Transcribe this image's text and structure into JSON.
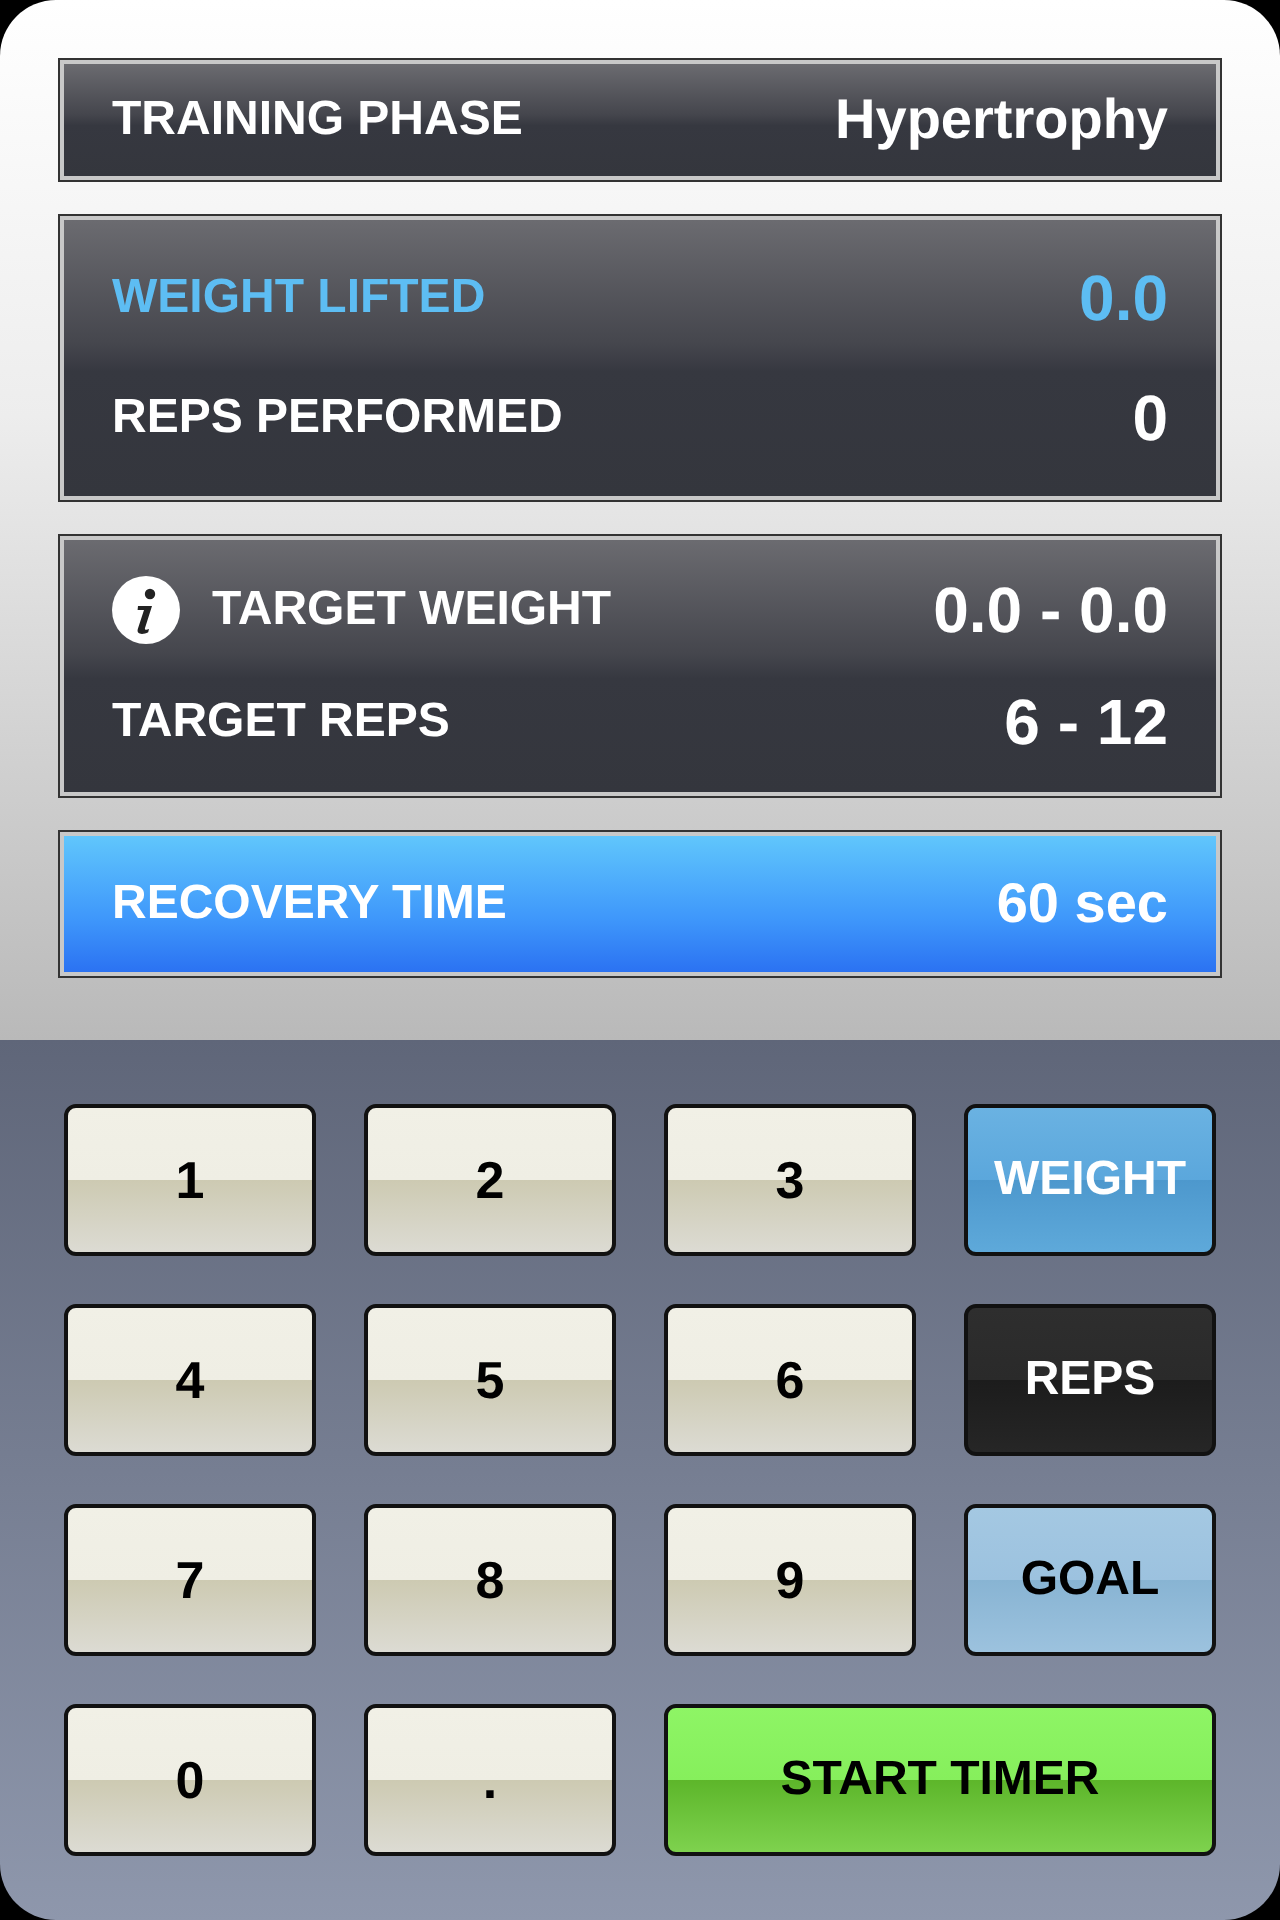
{
  "training_phase": {
    "label": "TRAINING PHASE",
    "value": "Hypertrophy"
  },
  "performed": [
    {
      "label": "WEIGHT LIFTED",
      "value": "0.0",
      "selected": true
    },
    {
      "label": "REPS PERFORMED",
      "value": "0",
      "selected": false
    }
  ],
  "targets": [
    {
      "label": "TARGET WEIGHT",
      "value": "0.0 - 0.0",
      "kind": "info"
    },
    {
      "label": "TARGET REPS",
      "value": "6 - 12",
      "kind": "plain"
    }
  ],
  "recovery": {
    "label": "RECOVERY TIME",
    "value": "60 sec"
  },
  "keys": [
    {
      "label": "1",
      "kind": "digit"
    },
    {
      "label": "2",
      "kind": "digit"
    },
    {
      "label": "3",
      "kind": "digit"
    },
    {
      "label": "WEIGHT",
      "kind": "weight"
    },
    {
      "label": "4",
      "kind": "digit"
    },
    {
      "label": "5",
      "kind": "digit"
    },
    {
      "label": "6",
      "kind": "digit"
    },
    {
      "label": "REPS",
      "kind": "reps"
    },
    {
      "label": "7",
      "kind": "digit"
    },
    {
      "label": "8",
      "kind": "digit"
    },
    {
      "label": "9",
      "kind": "digit"
    },
    {
      "label": "GOAL",
      "kind": "goal"
    },
    {
      "label": "0",
      "kind": "digit"
    },
    {
      "label": ".",
      "kind": "digit"
    },
    {
      "label": "START TIMER",
      "kind": "start"
    }
  ]
}
